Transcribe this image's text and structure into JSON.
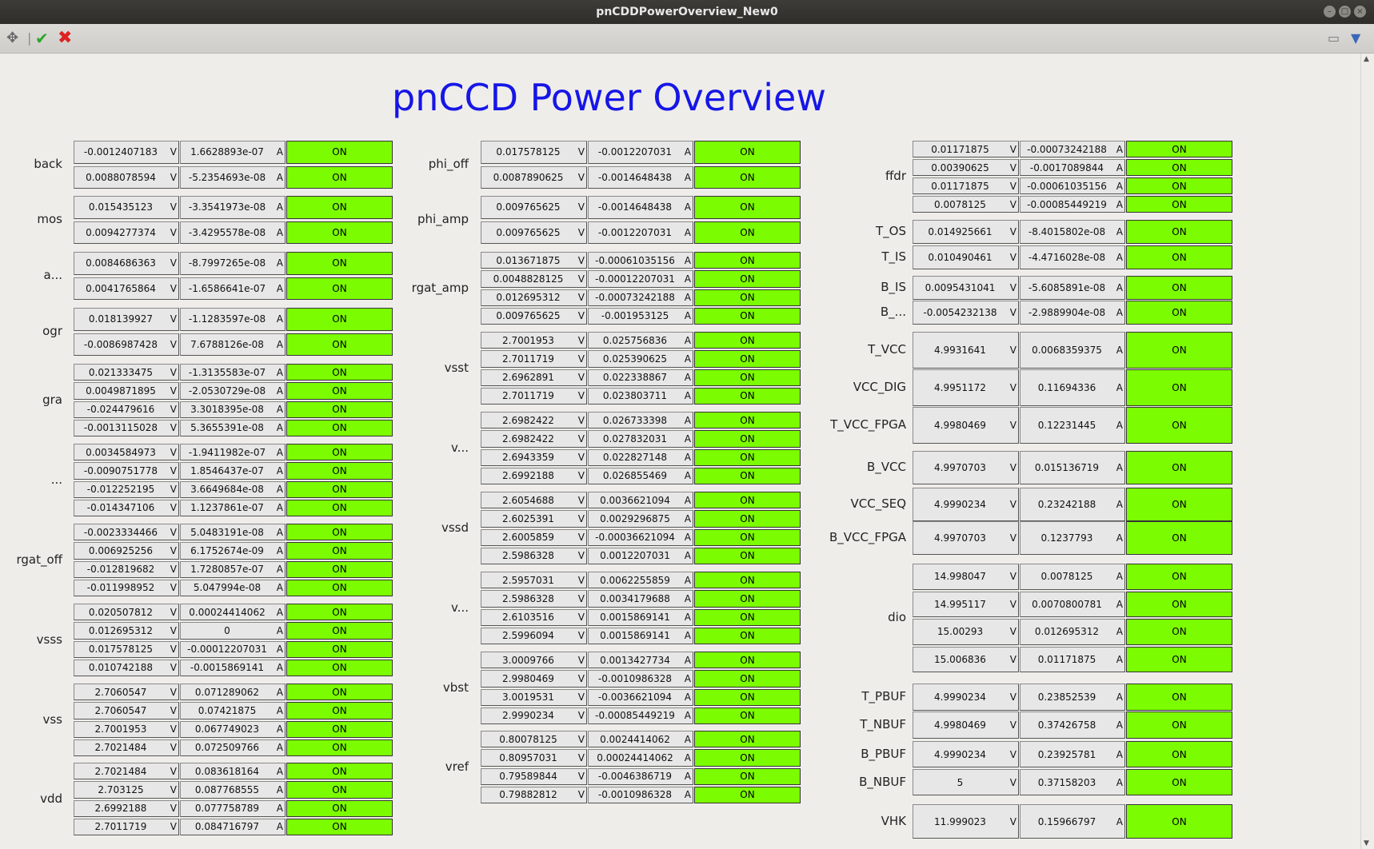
{
  "window": {
    "title": "pnCDDPowerOverview_New0"
  },
  "page_title": "pnCCD Power Overview",
  "units": {
    "voltage": "V",
    "current": "A"
  },
  "status_color": "#7cfc00",
  "columns": [
    {
      "groups": [
        {
          "label": "back",
          "rows": [
            [
              "-0.0012407183",
              "1.6628893e-07",
              "ON"
            ],
            [
              "0.0088078594",
              "-5.2354693e-08",
              "ON"
            ]
          ]
        },
        {
          "label": "mos",
          "rows": [
            [
              "0.015435123",
              "-3.3541973e-08",
              "ON"
            ],
            [
              "0.0094277374",
              "-3.4295578e-08",
              "ON"
            ]
          ]
        },
        {
          "label": "a...",
          "rows": [
            [
              "0.0084686363",
              "-8.7997265e-08",
              "ON"
            ],
            [
              "0.0041765864",
              "-1.6586641e-07",
              "ON"
            ]
          ]
        },
        {
          "label": "ogr",
          "rows": [
            [
              "0.018139927",
              "-1.1283597e-08",
              "ON"
            ],
            [
              "-0.0086987428",
              "7.6788126e-08",
              "ON"
            ]
          ]
        },
        {
          "label": "gra",
          "rows": [
            [
              "0.021333475",
              "-1.3135583e-07",
              "ON"
            ],
            [
              "0.0049871895",
              "-2.0530729e-08",
              "ON"
            ],
            [
              "-0.024479616",
              "3.3018395e-08",
              "ON"
            ],
            [
              "-0.0013115028",
              "5.3655391e-08",
              "ON"
            ]
          ]
        },
        {
          "label": "...",
          "rows": [
            [
              "0.0034584973",
              "-1.9411982e-07",
              "ON"
            ],
            [
              "-0.0090751778",
              "1.8546437e-07",
              "ON"
            ],
            [
              "-0.012252195",
              "3.6649684e-08",
              "ON"
            ],
            [
              "-0.014347106",
              "1.1237861e-07",
              "ON"
            ]
          ]
        },
        {
          "label": "rgat_off",
          "rows": [
            [
              "-0.0023334466",
              "5.0483191e-08",
              "ON"
            ],
            [
              "0.006925256",
              "6.1752674e-09",
              "ON"
            ],
            [
              "-0.012819682",
              "1.7280857e-07",
              "ON"
            ],
            [
              "-0.011998952",
              "5.047994e-08",
              "ON"
            ]
          ]
        },
        {
          "label": "vsss",
          "rows": [
            [
              "0.020507812",
              "0.00024414062",
              "ON"
            ],
            [
              "0.012695312",
              "0",
              "ON"
            ],
            [
              "0.017578125",
              "-0.00012207031",
              "ON"
            ],
            [
              "0.010742188",
              "-0.0015869141",
              "ON"
            ]
          ]
        },
        {
          "label": "vss",
          "rows": [
            [
              "2.7060547",
              "0.071289062",
              "ON"
            ],
            [
              "2.7060547",
              "0.07421875",
              "ON"
            ],
            [
              "2.7001953",
              "0.067749023",
              "ON"
            ],
            [
              "2.7021484",
              "0.072509766",
              "ON"
            ]
          ]
        },
        {
          "label": "vdd",
          "rows": [
            [
              "2.7021484",
              "0.083618164",
              "ON"
            ],
            [
              "2.703125",
              "0.087768555",
              "ON"
            ],
            [
              "2.6992188",
              "0.077758789",
              "ON"
            ],
            [
              "2.7011719",
              "0.084716797",
              "ON"
            ]
          ]
        }
      ]
    },
    {
      "groups": [
        {
          "label": "phi_off",
          "rows": [
            [
              "0.017578125",
              "-0.0012207031",
              "ON"
            ],
            [
              "0.0087890625",
              "-0.0014648438",
              "ON"
            ]
          ]
        },
        {
          "label": "phi_amp",
          "rows": [
            [
              "0.009765625",
              "-0.0014648438",
              "ON"
            ],
            [
              "0.009765625",
              "-0.0012207031",
              "ON"
            ]
          ]
        },
        {
          "label": "rgat_amp",
          "rows": [
            [
              "0.013671875",
              "-0.00061035156",
              "ON"
            ],
            [
              "0.0048828125",
              "-0.00012207031",
              "ON"
            ],
            [
              "0.012695312",
              "-0.00073242188",
              "ON"
            ],
            [
              "0.009765625",
              "-0.001953125",
              "ON"
            ]
          ]
        },
        {
          "label": "vsst",
          "rows": [
            [
              "2.7001953",
              "0.025756836",
              "ON"
            ],
            [
              "2.7011719",
              "0.025390625",
              "ON"
            ],
            [
              "2.6962891",
              "0.022338867",
              "ON"
            ],
            [
              "2.7011719",
              "0.023803711",
              "ON"
            ]
          ]
        },
        {
          "label": "v...",
          "rows": [
            [
              "2.6982422",
              "0.026733398",
              "ON"
            ],
            [
              "2.6982422",
              "0.027832031",
              "ON"
            ],
            [
              "2.6943359",
              "0.022827148",
              "ON"
            ],
            [
              "2.6992188",
              "0.026855469",
              "ON"
            ]
          ]
        },
        {
          "label": "vssd",
          "rows": [
            [
              "2.6054688",
              "0.0036621094",
              "ON"
            ],
            [
              "2.6025391",
              "0.0029296875",
              "ON"
            ],
            [
              "2.6005859",
              "-0.00036621094",
              "ON"
            ],
            [
              "2.5986328",
              "0.0012207031",
              "ON"
            ]
          ]
        },
        {
          "label": "v...",
          "rows": [
            [
              "2.5957031",
              "0.0062255859",
              "ON"
            ],
            [
              "2.5986328",
              "0.0034179688",
              "ON"
            ],
            [
              "2.6103516",
              "0.0015869141",
              "ON"
            ],
            [
              "2.5996094",
              "0.0015869141",
              "ON"
            ]
          ]
        },
        {
          "label": "vbst",
          "rows": [
            [
              "3.0009766",
              "0.0013427734",
              "ON"
            ],
            [
              "2.9980469",
              "-0.0010986328",
              "ON"
            ],
            [
              "3.0019531",
              "-0.0036621094",
              "ON"
            ],
            [
              "2.9990234",
              "-0.00085449219",
              "ON"
            ]
          ]
        },
        {
          "label": "vref",
          "rows": [
            [
              "0.80078125",
              "0.0024414062",
              "ON"
            ],
            [
              "0.80957031",
              "0.00024414062",
              "ON"
            ],
            [
              "0.79589844",
              "-0.0046386719",
              "ON"
            ],
            [
              "0.79882812",
              "-0.0010986328",
              "ON"
            ]
          ]
        }
      ]
    },
    {
      "groups": [
        {
          "label": "ffdr",
          "rows": [
            [
              "0.01171875",
              "-0.00073242188",
              "ON"
            ],
            [
              "0.00390625",
              "-0.0017089844",
              "ON"
            ],
            [
              "0.01171875",
              "-0.00061035156",
              "ON"
            ],
            [
              "0.0078125",
              "-0.00085449219",
              "ON"
            ]
          ]
        },
        {
          "label": "T_OS",
          "rows": [
            [
              "0.014925661",
              "-8.4015802e-08",
              "ON"
            ]
          ]
        },
        {
          "label": "T_IS",
          "rows": [
            [
              "0.010490461",
              "-4.4716028e-08",
              "ON"
            ]
          ]
        },
        {
          "label": "B_IS",
          "rows": [
            [
              "0.0095431041",
              "-5.6085891e-08",
              "ON"
            ]
          ]
        },
        {
          "label": "B_...",
          "rows": [
            [
              "-0.0054232138",
              "-2.9889904e-08",
              "ON"
            ]
          ]
        },
        {
          "label": "T_VCC",
          "rows": [
            [
              "4.9931641",
              "0.0068359375",
              "ON"
            ]
          ]
        },
        {
          "label": "VCC_DIG",
          "rows": [
            [
              "4.9951172",
              "0.11694336",
              "ON"
            ]
          ]
        },
        {
          "label": "T_VCC_FPGA",
          "rows": [
            [
              "4.9980469",
              "0.12231445",
              "ON"
            ]
          ]
        },
        {
          "label": "B_VCC",
          "rows": [
            [
              "4.9970703",
              "0.015136719",
              "ON"
            ]
          ]
        },
        {
          "label": "VCC_SEQ",
          "rows": [
            [
              "4.9990234",
              "0.23242188",
              "ON"
            ]
          ]
        },
        {
          "label": "B_VCC_FPGA",
          "rows": [
            [
              "4.9970703",
              "0.1237793",
              "ON"
            ]
          ]
        },
        {
          "label": "dio",
          "rows": [
            [
              "14.998047",
              "0.0078125",
              "ON"
            ],
            [
              "14.995117",
              "0.0070800781",
              "ON"
            ],
            [
              "15.00293",
              "0.012695312",
              "ON"
            ],
            [
              "15.006836",
              "0.01171875",
              "ON"
            ]
          ]
        },
        {
          "label": "T_PBUF",
          "rows": [
            [
              "4.9990234",
              "0.23852539",
              "ON"
            ]
          ]
        },
        {
          "label": "T_NBUF",
          "rows": [
            [
              "4.9980469",
              "0.37426758",
              "ON"
            ]
          ]
        },
        {
          "label": "B_PBUF",
          "rows": [
            [
              "4.9990234",
              "0.23925781",
              "ON"
            ]
          ]
        },
        {
          "label": "B_NBUF",
          "rows": [
            [
              "5",
              "0.37158203",
              "ON"
            ]
          ]
        },
        {
          "label": "VHK",
          "rows": [
            [
              "11.999023",
              "0.15966797",
              "ON"
            ]
          ]
        }
      ]
    }
  ]
}
